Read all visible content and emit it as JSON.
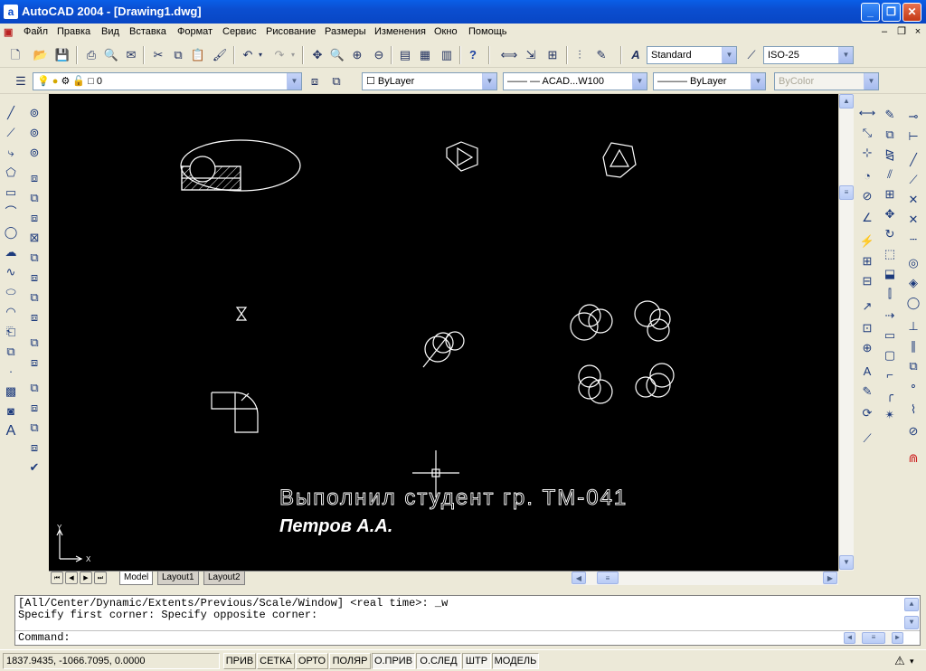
{
  "window": {
    "title": "AutoCAD 2004 - [Drawing1.dwg]",
    "app_icon": "autocad-icon"
  },
  "menu": [
    "Файл",
    "Правка",
    "Вид",
    "Вставка",
    "Формат",
    "Сервис",
    "Рисование",
    "Размеры",
    "Изменения",
    "Окно",
    "Помощь"
  ],
  "toolbar": {
    "text_style": "Standard",
    "dim_style": "ISO-25"
  },
  "properties": {
    "layer": "0",
    "color": "ByLayer",
    "linetype": "—— — ACAD...W100",
    "lineweight": "——— ByLayer",
    "plot_style": "ByColor"
  },
  "drawing": {
    "line1": "Выполнил студент гр. ТМ-041",
    "line2": "Петров А.А.",
    "ucs_x": "X",
    "ucs_y": "Y"
  },
  "tabs": [
    "Model",
    "Layout1",
    "Layout2"
  ],
  "command": {
    "history1": "[All/Center/Dynamic/Extents/Previous/Scale/Window] <real time>: _w",
    "history2": "Specify first corner: Specify opposite corner:",
    "prompt": "Command:"
  },
  "status": {
    "coords": "1837.9435, -1066.7095, 0.0000",
    "buttons": [
      "ПРИВ",
      "СЕТКА",
      "ОРТО",
      "ПОЛЯР",
      "О.ПРИВ",
      "О.СЛЕД",
      "ШТР",
      "МОДЕЛЬ"
    ]
  },
  "colors": {
    "canvas": "#000000",
    "drawing": "#ffffff",
    "titlebar": "#0a5fe8"
  }
}
